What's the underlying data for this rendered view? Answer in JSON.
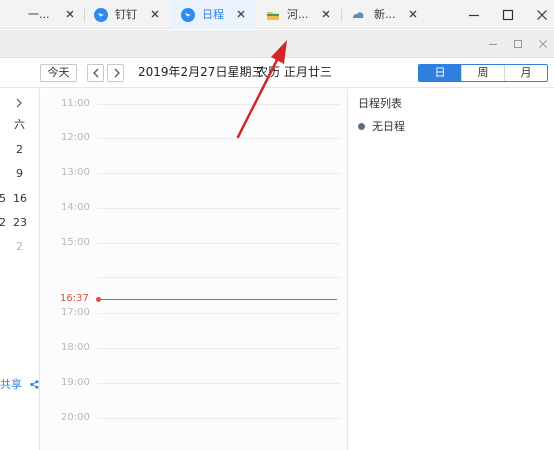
{
  "browser": {
    "tabs": [
      {
        "label": "一...",
        "icon": "doc-icon",
        "active": false
      },
      {
        "label": "钉钉",
        "icon": "dingtalk-icon",
        "active": false
      },
      {
        "label": "日程",
        "icon": "dingtalk-icon",
        "active": true
      },
      {
        "label": "河...",
        "icon": "folder-icon",
        "active": false
      },
      {
        "label": "新...",
        "icon": "cloud-icon",
        "active": false
      }
    ],
    "colors": {
      "tab_active_bg": "#eaf3fd",
      "accent": "#2d7fe0"
    }
  },
  "toolbar": {
    "today_label": "今天",
    "date_text": "2019年2月27日星期三",
    "lunar_text": "农历 正月廿三",
    "views": [
      "日",
      "周",
      "月"
    ],
    "active_view": "日"
  },
  "mini_calendar": {
    "visible_weekday": "六",
    "visible_rows": [
      {
        "left": "",
        "right": "2"
      },
      {
        "left": "",
        "right": "9"
      },
      {
        "left": "5",
        "right": "16"
      },
      {
        "left": "2",
        "right": "23"
      },
      {
        "left": "",
        "right": "2"
      }
    ],
    "share_label": "共享"
  },
  "day_grid": {
    "hours": [
      "11:00",
      "12:00",
      "13:00",
      "14:00",
      "15:00",
      "17:00",
      "18:00",
      "19:00",
      "20:00"
    ],
    "current_time": "16:37",
    "now_color": "#e64b3b"
  },
  "schedule_panel": {
    "title": "日程列表",
    "empty_text": "无日程"
  }
}
